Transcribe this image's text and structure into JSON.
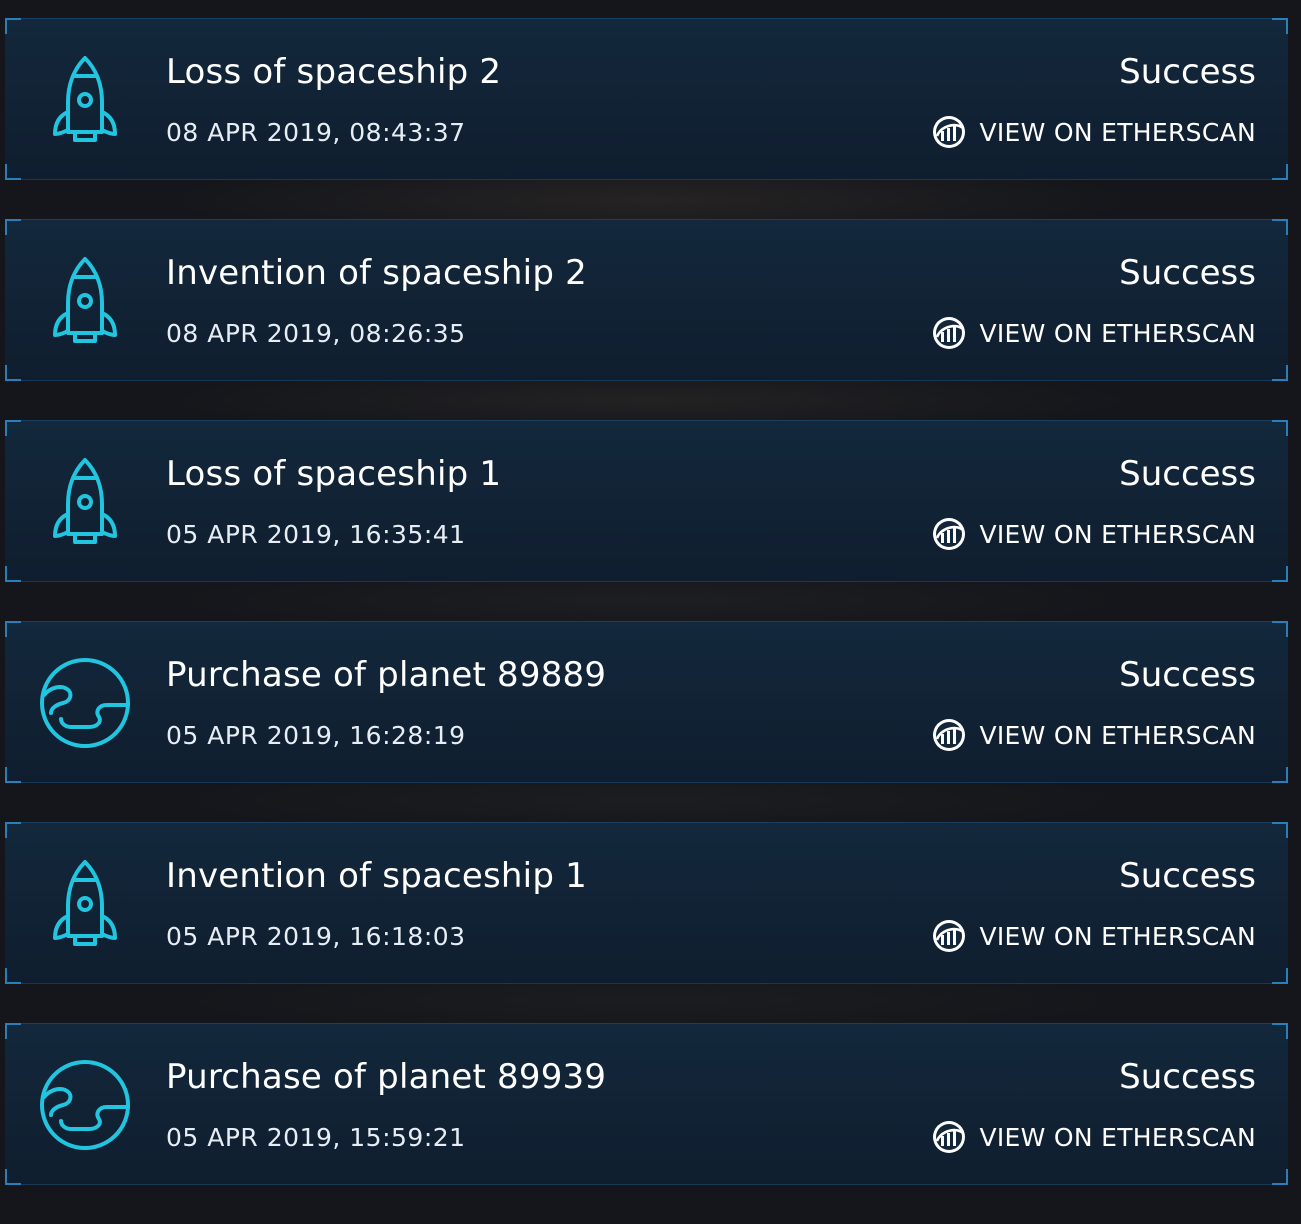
{
  "colors": {
    "accent": "#22c5e0",
    "card_border": "#2a7fb8",
    "card_background": "#112234",
    "page_background": "#14161b",
    "text": "#ffffff"
  },
  "transactions": [
    {
      "icon": "rocket-icon",
      "title": "Loss of spaceship 2",
      "timestamp": "08 APR 2019, 08:43:37",
      "status": "Success",
      "link_label": "VIEW ON ETHERSCAN"
    },
    {
      "icon": "rocket-icon",
      "title": "Invention of spaceship 2",
      "timestamp": "08 APR 2019, 08:26:35",
      "status": "Success",
      "link_label": "VIEW ON ETHERSCAN"
    },
    {
      "icon": "rocket-icon",
      "title": "Loss of spaceship 1",
      "timestamp": "05 APR 2019, 16:35:41",
      "status": "Success",
      "link_label": "VIEW ON ETHERSCAN"
    },
    {
      "icon": "planet-icon",
      "title": "Purchase of planet 89889",
      "timestamp": "05 APR 2019, 16:28:19",
      "status": "Success",
      "link_label": "VIEW ON ETHERSCAN"
    },
    {
      "icon": "rocket-icon",
      "title": "Invention of spaceship 1",
      "timestamp": "05 APR 2019, 16:18:03",
      "status": "Success",
      "link_label": "VIEW ON ETHERSCAN"
    },
    {
      "icon": "planet-icon",
      "title": "Purchase of planet 89939",
      "timestamp": "05 APR 2019, 15:59:21",
      "status": "Success",
      "link_label": "VIEW ON ETHERSCAN"
    }
  ]
}
